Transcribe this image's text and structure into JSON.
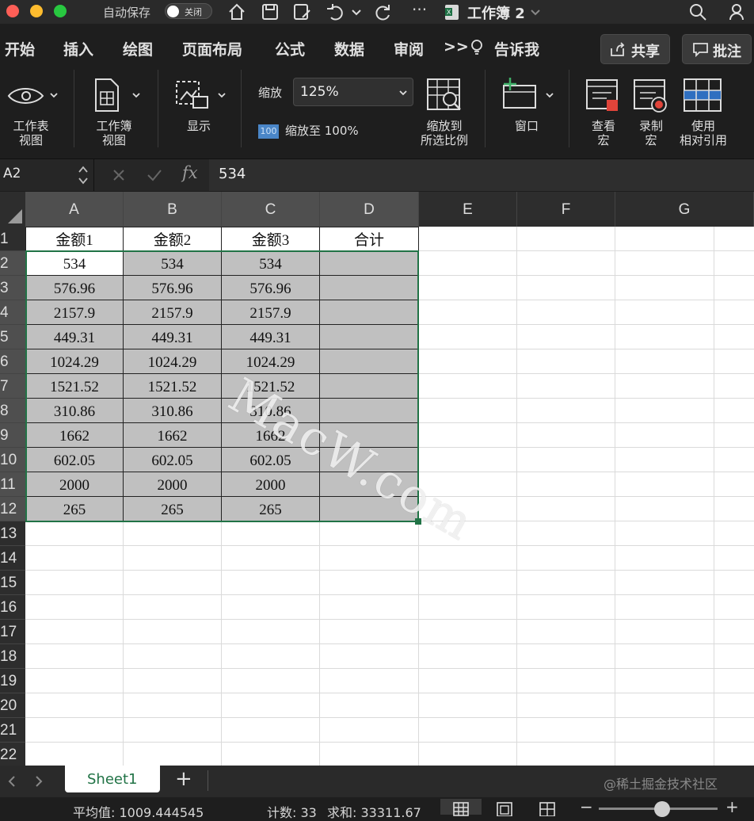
{
  "title_bar": {
    "autosave_label": "自动保存",
    "autosave_state": "关闭",
    "document_title": "工作簿 2",
    "traffic_light_colors": [
      "#fe5f57",
      "#febc2e",
      "#28c840"
    ]
  },
  "tabs": [
    "开始",
    "插入",
    "绘图",
    "页面布局",
    "公式",
    "数据",
    "审阅"
  ],
  "tabs_overflow": ">>",
  "tell_me": "告诉我",
  "share_label": "共享",
  "comments_label": "批注",
  "ribbon": {
    "worksheet_view": "工作表\n视图",
    "workbook_view": "工作簿\n视图",
    "show": "显示",
    "zoom_label": "缩放",
    "zoom_value": "125%",
    "zoom_100_badge": "100",
    "zoom_to_100": "缩放至 100%",
    "zoom_to_selection": "缩放到\n所选比例",
    "window": "窗口",
    "view_macros": "查看\n宏",
    "record_macro": "录制\n宏",
    "relative_refs": "使用\n相对引用"
  },
  "formula_bar": {
    "name_box": "A2",
    "fx": "fx",
    "value": "534"
  },
  "columns": [
    "A",
    "B",
    "C",
    "D",
    "E",
    "F",
    "G"
  ],
  "rows": [
    "1",
    "2",
    "3",
    "4",
    "5",
    "6",
    "7",
    "8",
    "9",
    "10",
    "11",
    "12",
    "13",
    "14",
    "15",
    "16",
    "17",
    "18",
    "19",
    "20",
    "21",
    "22"
  ],
  "headers": [
    "金额1",
    "金额2",
    "金额3",
    "合计"
  ],
  "table": [
    [
      "534",
      "534",
      "534",
      ""
    ],
    [
      "576.96",
      "576.96",
      "576.96",
      ""
    ],
    [
      "2157.9",
      "2157.9",
      "2157.9",
      ""
    ],
    [
      "449.31",
      "449.31",
      "449.31",
      ""
    ],
    [
      "1024.29",
      "1024.29",
      "1024.29",
      ""
    ],
    [
      "1521.52",
      "1521.52",
      "1521.52",
      ""
    ],
    [
      "310.86",
      "310.86",
      "310.86",
      ""
    ],
    [
      "1662",
      "1662",
      "1662",
      ""
    ],
    [
      "602.05",
      "602.05",
      "602.05",
      ""
    ],
    [
      "2000",
      "2000",
      "2000",
      ""
    ],
    [
      "265",
      "265",
      "265",
      ""
    ]
  ],
  "watermark": "MacW.com",
  "sheet_tab": "Sheet1",
  "add_sheet": "+",
  "sheet_watermark": "@稀土掘金技术社区",
  "status": {
    "average": "平均值: 1009.444545",
    "count": "计数: 33",
    "sum": "求和: 33311.67"
  },
  "colors": {
    "selection_fill": "#c0c0c0",
    "selection_border": "#217346",
    "sheet_tab_text": "#217346"
  }
}
